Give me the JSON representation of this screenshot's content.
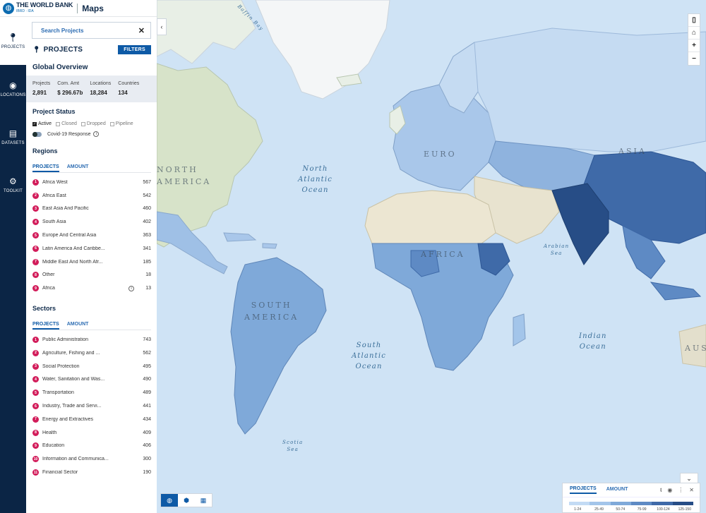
{
  "brand": {
    "org": "THE WORLD BANK",
    "sub": "IBRD · IDA",
    "app": "Maps"
  },
  "rail": [
    {
      "label": "PROJECTS",
      "icon": "pin-icon"
    },
    {
      "label": "LOCATIONS",
      "icon": "globe-icon"
    },
    {
      "label": "DATASETS",
      "icon": "datasets-icon"
    },
    {
      "label": "TOOLKIT",
      "icon": "toolkit-icon"
    }
  ],
  "search": {
    "placeholder": "Search Projects"
  },
  "projects": {
    "title": "PROJECTS",
    "filters": "FILTERS"
  },
  "overview": {
    "title": "Global Overview",
    "stats": [
      {
        "label": "Projects",
        "value": "2,891"
      },
      {
        "label": "Com. Amt",
        "value": "$ 296.67b"
      },
      {
        "label": "Locations",
        "value": "18,284"
      },
      {
        "label": "Countries",
        "value": "134"
      }
    ]
  },
  "status": {
    "title": "Project Status",
    "options": [
      {
        "label": "Active",
        "checked": true
      },
      {
        "label": "Closed",
        "checked": false
      },
      {
        "label": "Dropped",
        "checked": false
      },
      {
        "label": "Pipeline",
        "checked": false
      }
    ],
    "covid_label": "Covid-19 Response"
  },
  "regions": {
    "title": "Regions",
    "tabs": [
      "PROJECTS",
      "AMOUNT"
    ],
    "items": [
      {
        "n": "1",
        "name": "Africa West",
        "value": "567"
      },
      {
        "n": "2",
        "name": "Africa East",
        "value": "542"
      },
      {
        "n": "3",
        "name": "East Asia And Pacific",
        "value": "460"
      },
      {
        "n": "4",
        "name": "South Asia",
        "value": "402"
      },
      {
        "n": "5",
        "name": "Europe And Central Asia",
        "value": "363"
      },
      {
        "n": "6",
        "name": "Latin America And Caribbe...",
        "value": "341"
      },
      {
        "n": "7",
        "name": "Middle East And North Afr...",
        "value": "185"
      },
      {
        "n": "8",
        "name": "Other",
        "value": "18"
      },
      {
        "n": "9",
        "name": "Africa",
        "value": "13"
      }
    ]
  },
  "sectors": {
    "title": "Sectors",
    "tabs": [
      "PROJECTS",
      "AMOUNT"
    ],
    "items": [
      {
        "n": "1",
        "name": "Public Administration",
        "value": "743"
      },
      {
        "n": "2",
        "name": "Agriculture, Fishing and ...",
        "value": "562"
      },
      {
        "n": "3",
        "name": "Social Protection",
        "value": "495"
      },
      {
        "n": "4",
        "name": "Water, Sanitation and Was...",
        "value": "490"
      },
      {
        "n": "5",
        "name": "Transportation",
        "value": "489"
      },
      {
        "n": "6",
        "name": "Industry, Trade and Servi...",
        "value": "441"
      },
      {
        "n": "7",
        "name": "Energy and Extractives",
        "value": "434"
      },
      {
        "n": "8",
        "name": "Health",
        "value": "409"
      },
      {
        "n": "9",
        "name": "Education",
        "value": "406"
      },
      {
        "n": "10",
        "name": "Information and Communica...",
        "value": "300"
      },
      {
        "n": "11",
        "name": "Financial Sector",
        "value": "190"
      }
    ]
  },
  "map": {
    "labels": {
      "baffin": "Baffin Bay",
      "north_atlantic": [
        "North",
        "Atlantic",
        "Ocean"
      ],
      "south_atlantic": [
        "South",
        "Atlantic",
        "Ocean"
      ],
      "indian": [
        "Indian",
        "Ocean"
      ],
      "arabian": [
        "Arabian",
        "Sea"
      ],
      "scotia": [
        "Scotia",
        "Sea"
      ],
      "north_america": [
        "NORTH",
        "AMERICA"
      ],
      "south_america": [
        "SOUTH",
        "AMERICA"
      ],
      "europe": "EURO",
      "asia": "ASIA",
      "africa": "AFRICA",
      "australia": "AUS"
    },
    "controls": [
      "book-icon",
      "home-icon",
      "+",
      "−"
    ],
    "basemap_buttons": [
      "globe-icon",
      "hexagon-icon",
      "table-icon"
    ]
  },
  "legend": {
    "tabs": [
      "PROJECTS",
      "AMOUNT"
    ],
    "ranges": [
      "1-24",
      "25-49",
      "50-74",
      "75-99",
      "100-124",
      "125-150"
    ],
    "colors": [
      "#c3dbf4",
      "#a3c5ea",
      "#7fa9d9",
      "#5e8ac4",
      "#3f6aa8",
      "#274d86"
    ]
  },
  "colors": {
    "accent": "#0e5aa6",
    "rail": "#0b2545",
    "badge": "#d21c5a"
  }
}
